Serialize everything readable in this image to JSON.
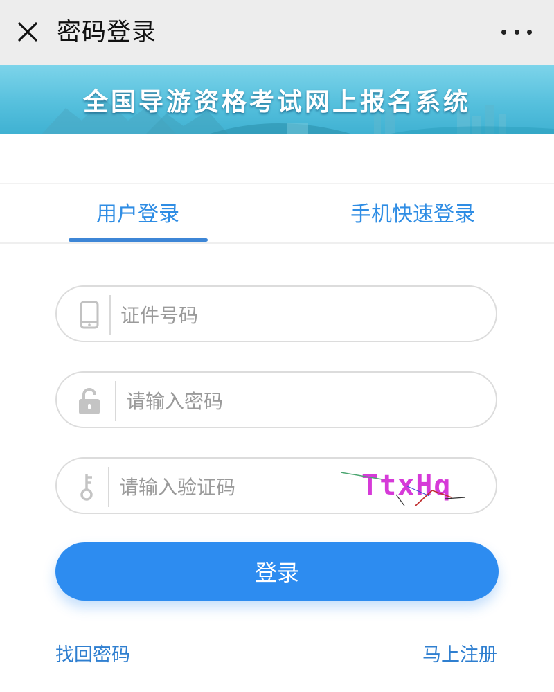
{
  "window": {
    "title": "密码登录",
    "close_icon": "close-icon",
    "more_icon": "more-icon"
  },
  "banner": {
    "title": "全国导游资格考试网上报名系统"
  },
  "tabs": [
    {
      "label": "用户登录",
      "active": true
    },
    {
      "label": "手机快速登录",
      "active": false
    }
  ],
  "form": {
    "id_field": {
      "placeholder": "证件号码",
      "value": "",
      "icon": "phone-icon"
    },
    "password_field": {
      "placeholder": "请输入密码",
      "value": "",
      "icon": "lock-icon"
    },
    "captcha_field": {
      "placeholder": "请输入验证码",
      "value": "",
      "icon": "key-icon"
    },
    "captcha_image_text": "TtxHq",
    "login_label": "登录"
  },
  "links": {
    "forgot": "找回密码",
    "register": "马上注册"
  },
  "colors": {
    "primary": "#2d8cf0",
    "tab_text": "#2f8de4",
    "link": "#2f7fd0",
    "captcha": "#d63ad8"
  }
}
